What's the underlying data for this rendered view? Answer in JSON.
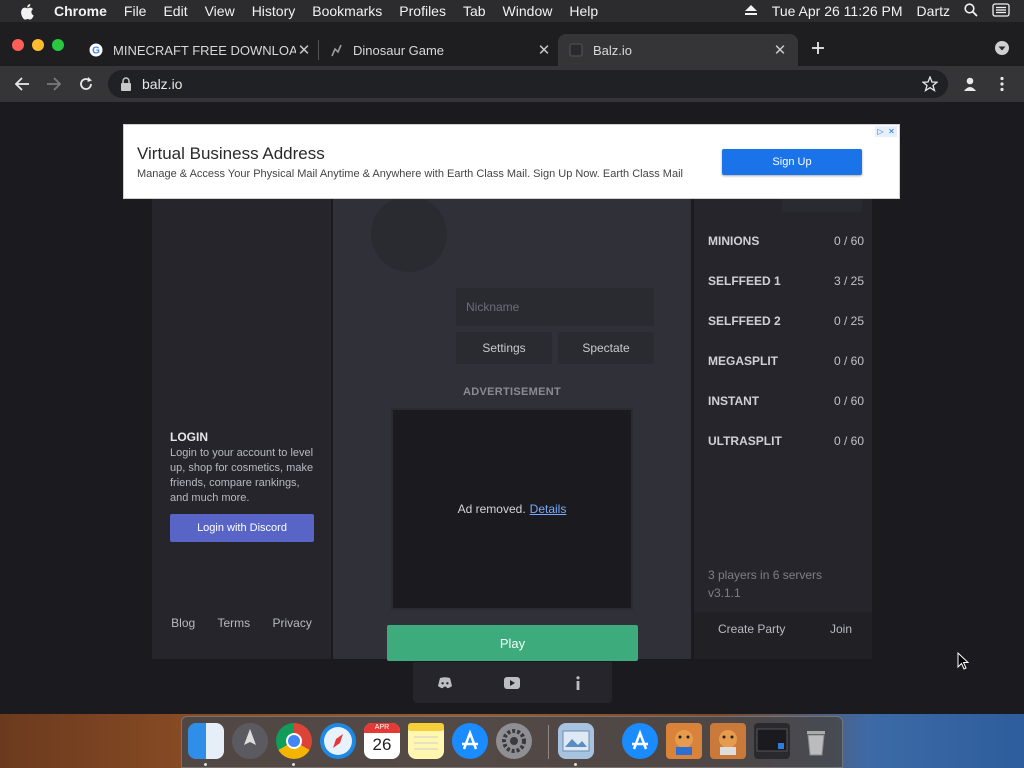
{
  "menubar": {
    "app_name": "Chrome",
    "items": [
      "File",
      "Edit",
      "View",
      "History",
      "Bookmarks",
      "Profiles",
      "Tab",
      "Window",
      "Help"
    ],
    "datetime": "Tue Apr 26  11:26 PM",
    "user": "Dartz"
  },
  "tabs": [
    {
      "label": "MINECRAFT FREE DOWNLOAD",
      "icon": "google-icon"
    },
    {
      "label": "Dinosaur Game",
      "icon": "dino-icon"
    },
    {
      "label": "Balz.io",
      "icon": "balz-icon",
      "active": true
    }
  ],
  "toolbar": {
    "url": "balz.io"
  },
  "ad_banner": {
    "title": "Virtual Business Address",
    "text": "Manage & Access Your Physical Mail Anytime & Anywhere with Earth Class Mail. Sign Up Now. Earth Class Mail",
    "button": "Sign Up"
  },
  "left_panel": {
    "login_title": "LOGIN",
    "login_text": "Login to your account to level up, shop for cosmetics, make friends, compare rankings, and much more.",
    "discord_button": "Login with Discord",
    "footer": [
      "Blog",
      "Terms",
      "Privacy"
    ]
  },
  "mid_panel": {
    "nickname_placeholder": "Nickname",
    "settings_button": "Settings",
    "spectate_button": "Spectate",
    "advertisement_label": "ADVERTISEMENT",
    "ad_removed_text": "Ad removed.",
    "ad_details_link": "Details",
    "play_button": "Play"
  },
  "right_panel": {
    "modes": [
      {
        "name": "MINIONS",
        "count": "0 / 60"
      },
      {
        "name": "SELFFEED 1",
        "count": "3 / 25"
      },
      {
        "name": "SELFFEED 2",
        "count": "0 / 25"
      },
      {
        "name": "MEGASPLIT",
        "count": "0 / 60"
      },
      {
        "name": "INSTANT",
        "count": "0 / 60"
      },
      {
        "name": "ULTRASPLIT",
        "count": "0 / 60"
      }
    ],
    "players_info": "3 players in 6 servers",
    "version": "v3.1.1",
    "create_party": "Create Party",
    "join": "Join"
  },
  "icon_bar": [
    "discord-icon",
    "youtube-icon",
    "info-icon"
  ],
  "dock": {
    "calendar_month": "APR",
    "calendar_day": "26"
  },
  "colors": {
    "play_green": "#3dab7b",
    "discord_blue": "#5865c6",
    "ad_button_blue": "#1a73e8"
  }
}
